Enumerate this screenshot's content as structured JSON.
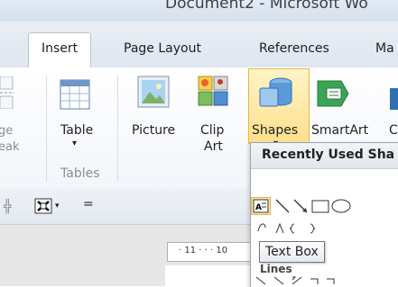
{
  "window": {
    "title": "Document2 - Microsoft Wo"
  },
  "tabs": [
    {
      "label": "Insert",
      "active": true
    },
    {
      "label": "Page Layout"
    },
    {
      "label": "References"
    },
    {
      "label": "Ma"
    }
  ],
  "ribbon": {
    "pagebreak": {
      "line1": "ge",
      "line2": "eak"
    },
    "table": {
      "label": "Table",
      "arrow": "▾"
    },
    "picture": {
      "label": "Picture"
    },
    "clipart": {
      "line1": "Clip",
      "line2": "Art"
    },
    "shapes": {
      "label": "Shapes",
      "arrow": "▾"
    },
    "smartart": {
      "label": "SmartArt"
    },
    "chart": {
      "label": "C"
    },
    "group_tables": "Tables"
  },
  "qat": {
    "more": "="
  },
  "ruler": {
    "text": "· 11 ·  ·  · 10"
  },
  "shapes_menu": {
    "header": "Recently Used Sha",
    "tooltip": "Text Box",
    "lines_label": "Lines"
  },
  "colors": {
    "accent": "#ffe08d",
    "accent_border": "#e3b64a",
    "tab_border": "#b9c4d2",
    "icon_blue": "#2f6fb3"
  }
}
